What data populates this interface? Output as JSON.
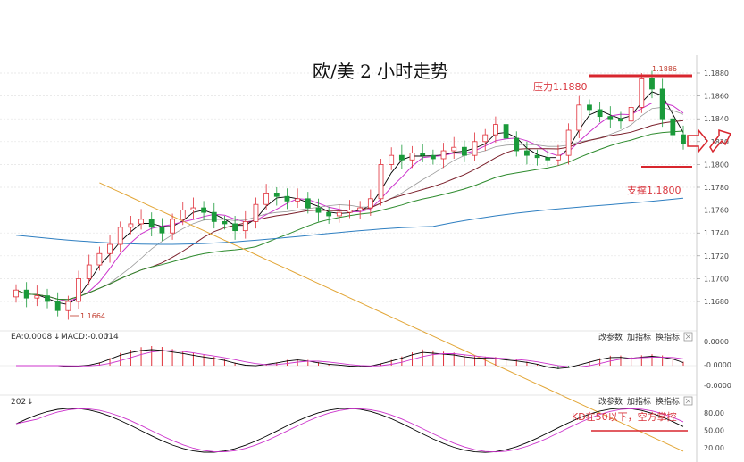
{
  "title": "欧/美 2 小时走势",
  "annotations": {
    "resistance": "压力1.1880",
    "support": "支撑1.1800",
    "kd_note": "KD在50以下，空方掌控",
    "high_label": "1.1886",
    "low_label": "1.1664"
  },
  "panels": {
    "macd_header": "EA:0.0008",
    "macd_value": "MACD:-0.0014",
    "kd_header": "202",
    "buttons": {
      "change_params": "改参数",
      "add_indicator": "加指标",
      "swap_indicator": "换指标"
    }
  },
  "colors": {
    "up": "#e0303a",
    "down": "#1a9a3a",
    "resistance_line": "#d8262e",
    "ma_fast": "#000000",
    "ma_pink": "#cc33cc",
    "ma_gray": "#999999",
    "ma_maroon": "#7a1f2a",
    "ma_green": "#2e8b2e",
    "ma_blue": "#2f7fc1",
    "ma_orange": "#e2a535"
  },
  "chart_data": {
    "type": "candlestick",
    "title": "欧/美 2 小时走势",
    "ylim": [
      1.166,
      1.189
    ],
    "y_ticks": [
      "1.1880",
      "1.1860",
      "1.1840",
      "1.1820",
      "1.1800",
      "1.1780",
      "1.1760",
      "1.1740",
      "1.1720",
      "1.1700",
      "1.1680"
    ],
    "resistance": 1.188,
    "support": 1.18,
    "high": 1.1886,
    "low": 1.1664,
    "close_path": [
      1.169,
      1.1683,
      1.1685,
      1.168,
      1.1672,
      1.168,
      1.17,
      1.1712,
      1.1722,
      1.173,
      1.1745,
      1.1748,
      1.1752,
      1.1745,
      1.174,
      1.1752,
      1.176,
      1.1762,
      1.1758,
      1.175,
      1.1748,
      1.1742,
      1.175,
      1.1765,
      1.1775,
      1.1772,
      1.1768,
      1.177,
      1.1762,
      1.1758,
      1.1755,
      1.1758,
      1.176,
      1.1762,
      1.177,
      1.18,
      1.1808,
      1.1804,
      1.181,
      1.1808,
      1.1805,
      1.1812,
      1.1815,
      1.1808,
      1.182,
      1.1826,
      1.1835,
      1.1823,
      1.1812,
      1.1808,
      1.1806,
      1.1804,
      1.1808,
      1.183,
      1.1852,
      1.1848,
      1.1842,
      1.184,
      1.1838,
      1.185,
      1.1875,
      1.1866,
      1.184,
      1.1826,
      1.1818
    ],
    "macd": {
      "value": -0.0014,
      "ea": 0.0008,
      "y_ticks": [
        "0.0000",
        "-0.0000",
        "-0.0000"
      ]
    },
    "kd": {
      "y_ticks": [
        "80.00",
        "50.00",
        "20.00"
      ]
    }
  }
}
